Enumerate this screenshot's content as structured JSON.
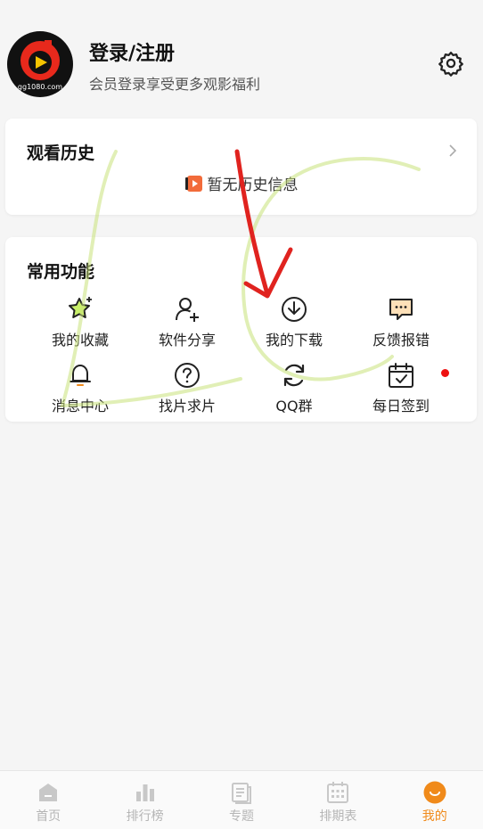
{
  "profile": {
    "title": "登录/注册",
    "subtitle": "会员登录享受更多观影福利",
    "avatar_watermark": "gg1080.com",
    "settings_icon": "gear-icon"
  },
  "history": {
    "title": "观看历史",
    "empty_text": "暂无历史信息",
    "chevron_icon": "chevron-right-icon",
    "empty_icon": "video-icon"
  },
  "functions": {
    "title": "常用功能",
    "items": [
      {
        "label": "我的收藏",
        "icon": "star-icon"
      },
      {
        "label": "软件分享",
        "icon": "user-add-icon"
      },
      {
        "label": "我的下载",
        "icon": "download-icon"
      },
      {
        "label": "反馈报错",
        "icon": "message-icon"
      },
      {
        "label": "消息中心",
        "icon": "bell-icon"
      },
      {
        "label": "找片求片",
        "icon": "question-icon"
      },
      {
        "label": "QQ群",
        "icon": "refresh-icon"
      },
      {
        "label": "每日签到",
        "icon": "calendar-check-icon",
        "badge": true
      }
    ]
  },
  "tabbar": {
    "tabs": [
      {
        "label": "首页",
        "icon": "home-icon",
        "active": false
      },
      {
        "label": "排行榜",
        "icon": "chart-icon",
        "active": false
      },
      {
        "label": "专题",
        "icon": "topic-icon",
        "active": false
      },
      {
        "label": "排期表",
        "icon": "calendar-icon",
        "active": false
      },
      {
        "label": "我的",
        "icon": "smile-icon",
        "active": true
      }
    ]
  },
  "colors": {
    "accent": "#f08a1a",
    "badge": "#ee1111",
    "annotation_arrow": "#e0231f",
    "annotation_scribble": "#c8e27a"
  }
}
